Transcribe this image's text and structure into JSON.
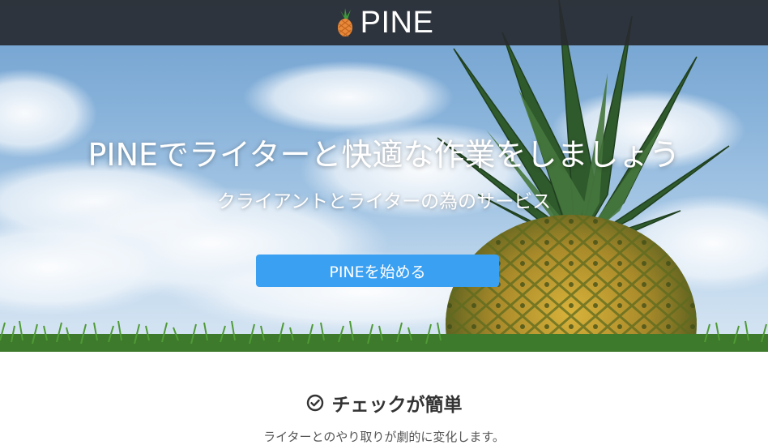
{
  "navbar": {
    "brand_text": "PINE",
    "brand_icon": "pineapple-icon"
  },
  "hero": {
    "title": "PINEでライターと快適な作業をしましょう",
    "subtitle": "クライアントとライターの為のサービス",
    "cta_label": "PINEを始める",
    "background_image": "pineapple-against-blue-sky"
  },
  "feature": {
    "icon": "check-circle-icon",
    "title": "チェックが簡単",
    "description": "ライターとのやり取りが劇的に変化します。"
  },
  "colors": {
    "navbar_bg": "#2b2d31",
    "cta_bg": "#3aa0f2",
    "text_dark": "#333333"
  }
}
